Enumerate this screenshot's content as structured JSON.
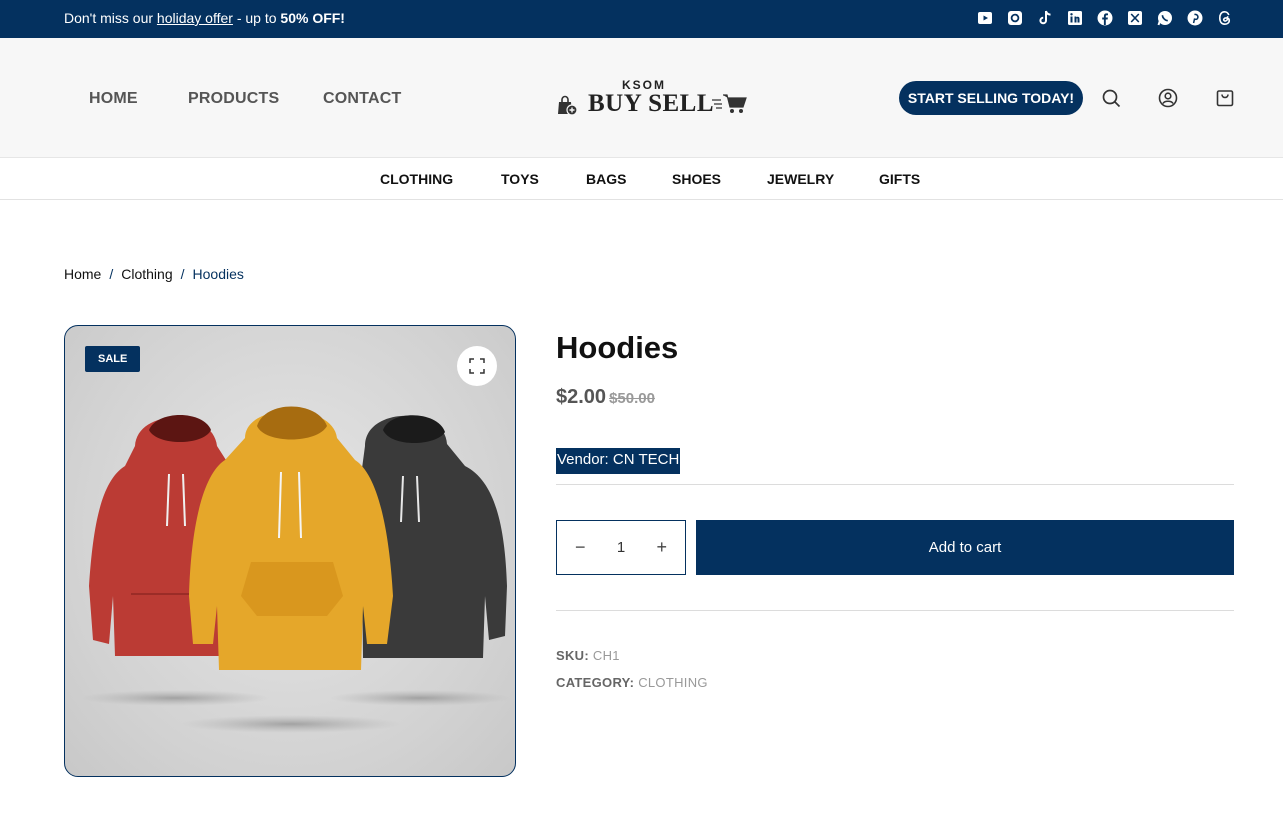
{
  "announcement": {
    "prefix": "Don't miss our ",
    "link": "holiday offer",
    "middle": " - up to ",
    "highlight": "50% OFF!"
  },
  "social_icons": [
    "youtube-icon",
    "instagram-icon",
    "tiktok-icon",
    "linkedin-icon",
    "facebook-icon",
    "x-icon",
    "whatsapp-icon",
    "pinterest-icon",
    "threads-icon"
  ],
  "nav": {
    "home": "HOME",
    "products": "PRODUCTS",
    "contact": "CONTACT"
  },
  "logo": {
    "top": "KSOM",
    "main": "BUY SELL"
  },
  "header": {
    "cta": "START SELLING TODAY!"
  },
  "categories": [
    "CLOTHING",
    "TOYS",
    "BAGS",
    "SHOES",
    "JEWELRY",
    "GIFTS"
  ],
  "breadcrumb": {
    "home": "Home",
    "parent": "Clothing",
    "current": "Hoodies",
    "separator": "/"
  },
  "product": {
    "badge": "SALE",
    "title": "Hoodies",
    "price": "$2.00",
    "old_price": "$50.00",
    "vendor": "Vendor: CN TECH",
    "quantity": "1",
    "minus": "−",
    "plus": "+",
    "add_to_cart": "Add to cart",
    "sku_label": "SKU:",
    "sku": "CH1",
    "category_label": "CATEGORY:",
    "category": "CLOTHING"
  },
  "colors": {
    "brand": "#04315f",
    "header_bg": "#f7f7f7"
  }
}
